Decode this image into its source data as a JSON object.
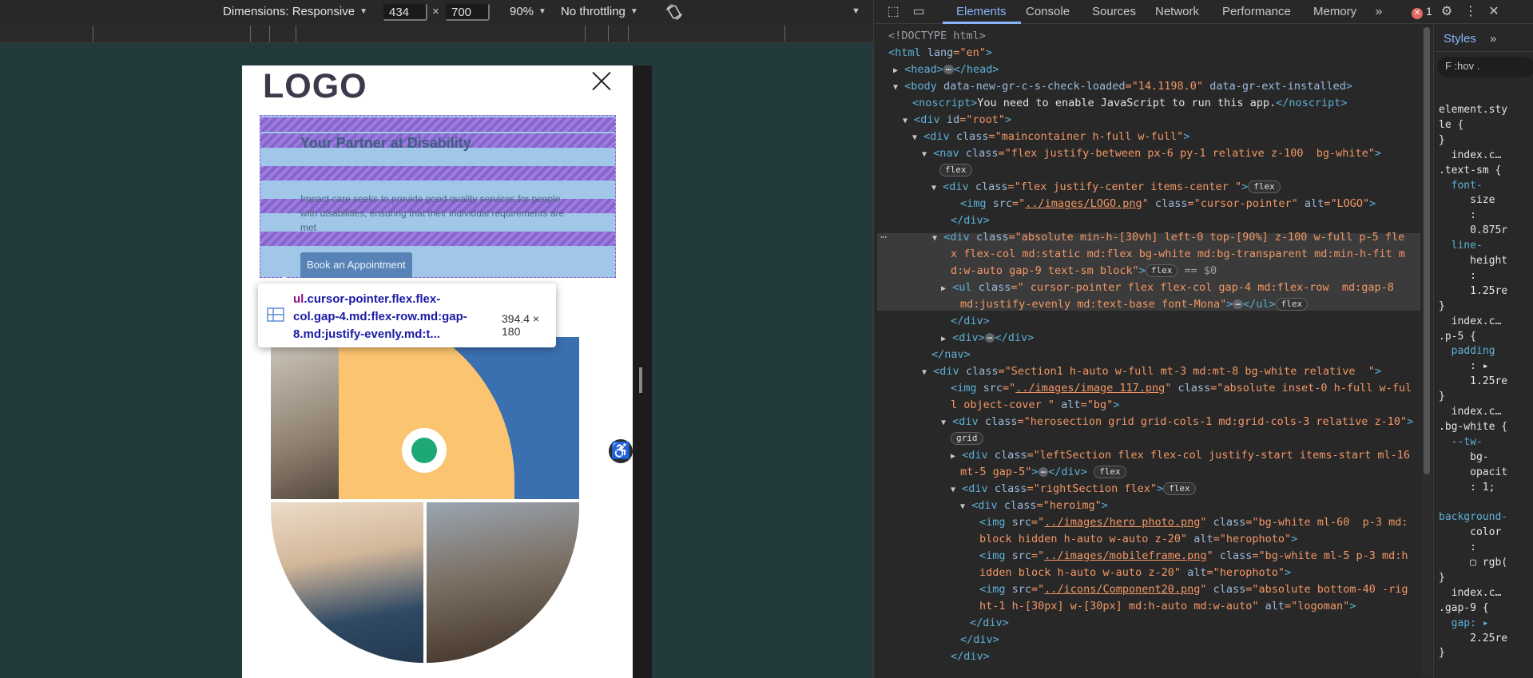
{
  "emulation_toolbar": {
    "dimensions_label": "Dimensions: Responsive",
    "width": "434",
    "times": "×",
    "height": "700",
    "zoom": "90%",
    "throttling": "No throttling"
  },
  "device_page": {
    "logo": "LOGO",
    "hero_title": "Your Partner at Disability",
    "hero_text": "Impact care seeks to provide good quality services for people with disabilities, ensuring that their individual requirements are met",
    "hero_button": "Book an Appointment",
    "tooltip": {
      "tag": "ul",
      "selector": ".cursor-pointer.flex.flex-col.gap-4.md:flex-row.md:gap-8.md:justify-evenly.md:t...",
      "size": "394.4 × 180"
    }
  },
  "devtools": {
    "tabs": [
      "Elements",
      "Console",
      "Sources",
      "Network",
      "Performance",
      "Memory"
    ],
    "active_tab": "Elements",
    "error_count": "1",
    "dom_lines": {
      "l01": "<!DOCTYPE html>",
      "l02_a": "<html",
      "l02_b": " lang",
      "l02_c": "=\"en\"",
      "l02_d": ">",
      "l03": "<head>",
      "l03_end": "</head>",
      "l04_a": "<body",
      "l04_b": " data-new-gr-c-s-check-loaded",
      "l04_c": "=\"14.1198.0\"",
      "l04_d": " data-gr-ext-installed",
      "l04_e": ">",
      "l05_a": "<noscript>",
      "l05_b": "You need to enable JavaScript to run this app.",
      "l05_c": "</noscript>",
      "l06_a": "<div",
      "l06_b": " id",
      "l06_c": "=\"root\"",
      "l06_d": ">",
      "l07_a": "<div",
      "l07_b": " class",
      "l07_c": "=\"maincontainer h-full w-full\"",
      "l07_d": ">",
      "l08_a": "<nav",
      "l08_b": " class",
      "l08_c": "=\"flex justify-between px-6 py-1 relative z-100  bg-white\"",
      "l08_d": ">",
      "pill_flex": "flex",
      "pill_grid": "grid",
      "l10_a": "<div",
      "l10_b": " class",
      "l10_c": "=\"flex justify-center items-center \"",
      "l10_d": ">",
      "l11_a": "<img",
      "l11_b": " src",
      "l11_c": "=\"",
      "l11_d": "../images/LOGO.png",
      "l11_e": "\"",
      "l11_f": " class",
      "l11_g": "=\"cursor-pointer\"",
      "l11_h": " alt",
      "l11_i": "=\"LOGO\"",
      "l11_j": ">",
      "l12": "</div>",
      "l13_a": "<div",
      "l13_b": " class",
      "l13_c": "=\"absolute min-h-[30vh] left-0 top-[90%] z-100 w-full p-5 fle",
      "l14": "x flex-col md:static md:flex bg-white md:bg-transparent md:min-h-fit m",
      "l15_a": "d:w-auto gap-9 text-sm block\"",
      "l15_b": ">",
      "l15_c": " == $0",
      "l16_a": "<ul",
      "l16_b": " class",
      "l16_c": "=\" cursor-pointer flex flex-col gap-4 md:flex-row  md:gap-8",
      "l17_a": "md:justify-evenly md:text-base font-Mona\"",
      "l17_b": ">",
      "l17_c": "</ul>",
      "l18": "</div>",
      "l19_a": "<div>",
      "l19_b": "</div>",
      "l20": "</nav>",
      "l21_a": "<div",
      "l21_b": " class",
      "l21_c": "=\"Section1 h-auto w-full mt-3 md:mt-8 bg-white relative  \"",
      "l21_d": ">",
      "l22_a": "<img",
      "l22_b": " src",
      "l22_c": "=\"",
      "l22_d": "../images/image 117.png",
      "l22_e": "\"",
      "l22_f": " class",
      "l22_g": "=\"absolute inset-0 h-full w-ful",
      "l23_a": "l object-cover \"",
      "l23_b": " alt",
      "l23_c": "=\"bg\"",
      "l23_d": ">",
      "l24_a": "<div",
      "l24_b": " class",
      "l24_c": "=\"herosection grid grid-cols-1 md:grid-cols-3 relative z-10\"",
      "l24_d": ">",
      "l26_a": "<div",
      "l26_b": " class",
      "l26_c": "=\"leftSection flex flex-col justify-start items-start ml-16",
      "l27_a": "mt-5 gap-5\"",
      "l27_b": ">",
      "l27_c": "</div>",
      "l28_a": "<div",
      "l28_b": " class",
      "l28_c": "=\"rightSection flex\"",
      "l28_d": ">",
      "l29_a": "<div",
      "l29_b": " class",
      "l29_c": "=\"heroimg\"",
      "l29_d": ">",
      "l30_a": "<img",
      "l30_b": " src",
      "l30_c": "=\"",
      "l30_d": "../images/hero photo.png",
      "l30_e": "\"",
      "l30_f": " class",
      "l30_g": "=\"bg-white ml-60  p-3 md:",
      "l31_a": "block hidden h-auto w-auto z-20\"",
      "l31_b": " alt",
      "l31_c": "=\"herophoto\"",
      "l31_d": ">",
      "l32_d": "../images/mobileframe.png",
      "l32_g": "=\"bg-white ml-5 p-3 md:h",
      "l33_a": "idden block h-auto w-auto z-20\"",
      "l34_d": "../icons/Component20.png",
      "l34_g": "=\"absolute bottom-40 -rig",
      "l35_a": "ht-1 h-[30px] w-[30px] md:h-auto md:w-auto\"",
      "l35_c": "=\"logoman\"",
      "l36": "</div>",
      "l37": "</div>",
      "l38": "</div>"
    },
    "styles_panel": {
      "tab": "Styles",
      "filter": "F :hov .",
      "lines": [
        "element.sty",
        "le {",
        "}",
        "  index.c…",
        ".text-sm {",
        "  font-",
        "     size",
        "     :",
        "     0.875r",
        "  line-",
        "     height",
        "     :",
        "     1.25re",
        "}",
        "  index.c…",
        ".p-5 {",
        "  padding",
        "     : ▸",
        "     1.25re",
        "}",
        "  index.c…",
        ".bg-white {",
        "  --tw-",
        "     bg-",
        "     opacit",
        "     : 1;",
        "",
        "background-",
        "     color",
        "     :",
        "     ▢ rgb(",
        "}",
        "  index.c…",
        ".gap-9 {",
        "  gap: ▸",
        "     2.25re",
        "}"
      ]
    }
  },
  "colors": {
    "devtools_bg": "#282828",
    "accent": "#8ab4f8",
    "emulation_bg": "#233a3d",
    "highlight": "#6fa8dc"
  }
}
